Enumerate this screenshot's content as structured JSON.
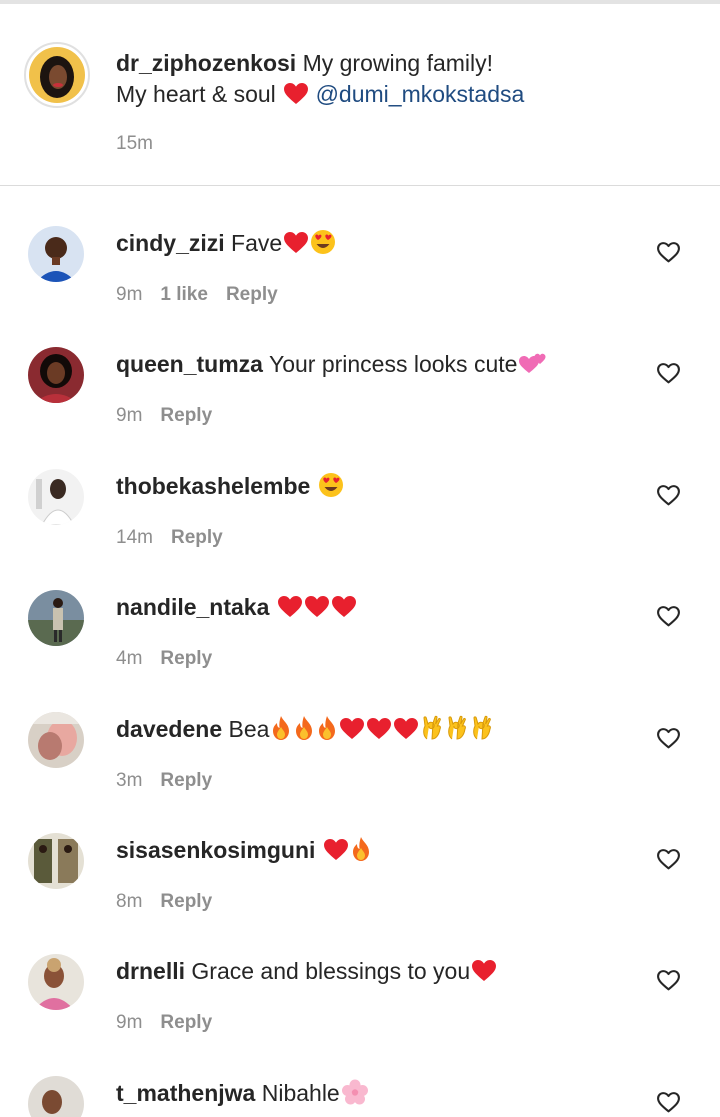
{
  "caption": {
    "username": "dr_ziphozenkosi",
    "text_line1": "My growing family!",
    "text_line2": "My heart & soul",
    "mention": "@dumi_mkokstadsa",
    "time": "15m"
  },
  "comments": [
    {
      "username": "cindy_zizi",
      "text": "Fave",
      "emojis": "heart-red,heart-eyes",
      "time": "9m",
      "likes": "1 like",
      "reply": "Reply"
    },
    {
      "username": "queen_tumza",
      "text": "Your princess looks cute",
      "emojis": "two-hearts",
      "time": "9m",
      "likes": "",
      "reply": "Reply"
    },
    {
      "username": "thobekashelembe",
      "text": "",
      "emojis": "heart-eyes",
      "time": "14m",
      "likes": "",
      "reply": "Reply"
    },
    {
      "username": "nandile_ntaka",
      "text": "",
      "emojis": "heart-red,heart-red,heart-red",
      "time": "4m",
      "likes": "",
      "reply": "Reply"
    },
    {
      "username": "davedene",
      "text": "Bea",
      "emojis": "fire,fire,fire,heart-red,heart-red,heart-red,ok-hand,ok-hand,ok-hand",
      "time": "3m",
      "likes": "",
      "reply": "Reply"
    },
    {
      "username": "sisasenkosimguni",
      "text": "",
      "emojis": "heart-red,fire",
      "time": "8m",
      "likes": "",
      "reply": "Reply"
    },
    {
      "username": "drnelli",
      "text": "Grace and blessings to you",
      "emojis": "heart-red",
      "time": "9m",
      "likes": "",
      "reply": "Reply"
    },
    {
      "username": "t_mathenjwa",
      "text": "Nibahle",
      "emojis": "cherry-blossom",
      "time": "",
      "likes": "",
      "reply": ""
    }
  ],
  "colors": {
    "text": "#262626",
    "muted": "#8e8e8e",
    "mention": "#1f4b80",
    "heart": "#e8202e"
  }
}
